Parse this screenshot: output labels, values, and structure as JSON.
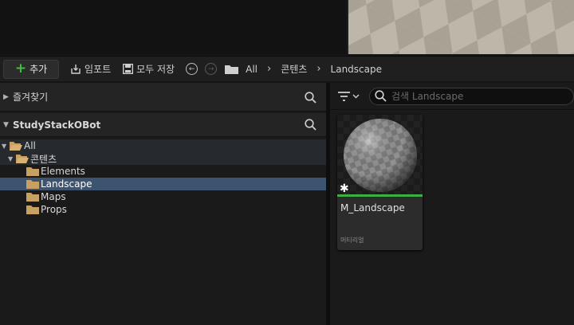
{
  "colors": {
    "accent_green": "#3fbf3f",
    "selection": "#3d5470",
    "folder": "#c9a063",
    "material_bar": "#3cb043"
  },
  "toolbar": {
    "add_label": "추가",
    "import_label": "임포트",
    "save_all_label": "모두 저장",
    "breadcrumbs": [
      "All",
      "콘텐츠",
      "Landscape"
    ]
  },
  "favorites": {
    "title": "즐겨찾기"
  },
  "project": {
    "title": "StudyStackOBot"
  },
  "tree": {
    "items": [
      {
        "label": "All"
      },
      {
        "label": "콘텐츠"
      },
      {
        "label": "Elements"
      },
      {
        "label": "Landscape"
      },
      {
        "label": "Maps"
      },
      {
        "label": "Props"
      }
    ]
  },
  "search": {
    "placeholder": "검색 Landscape"
  },
  "assets": [
    {
      "name": "M_Landscape",
      "type": "머티리얼"
    }
  ],
  "icons": {
    "add": "plus-icon",
    "import": "import-icon",
    "save": "save-icon",
    "back": "back-arrow-icon",
    "forward": "forward-arrow-icon",
    "folder": "folder-icon",
    "search": "search-icon",
    "filter": "filter-icon"
  }
}
